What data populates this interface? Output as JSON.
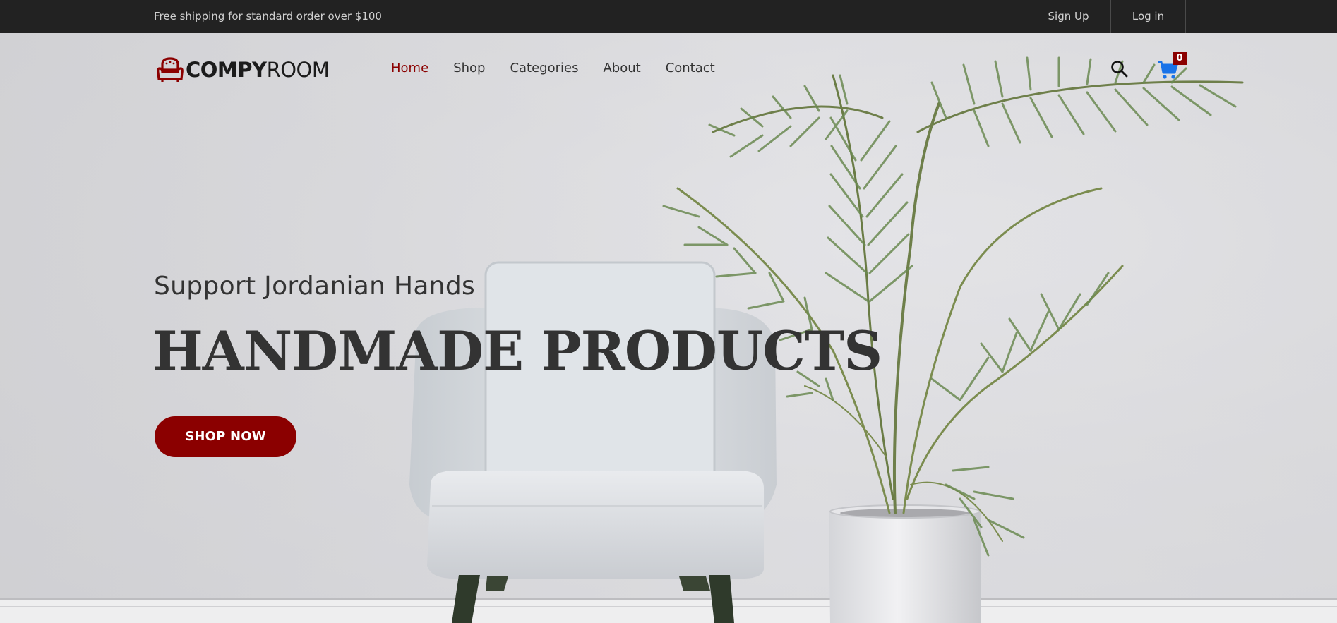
{
  "topbar": {
    "promo": "Free shipping for standard order over $100",
    "signup": "Sign Up",
    "login": "Log in"
  },
  "logo": {
    "bold": "COMPY",
    "light": "ROOM",
    "icon": "armchair-icon",
    "color": "#8b0000"
  },
  "nav": {
    "items": [
      {
        "label": "Home",
        "active": true
      },
      {
        "label": "Shop"
      },
      {
        "label": "Categories"
      },
      {
        "label": "About"
      },
      {
        "label": "Contact"
      }
    ]
  },
  "header": {
    "search_icon": "search-icon",
    "cart_icon": "cart-icon",
    "cart_count": "0"
  },
  "hero": {
    "subtitle": "Support Jordanian Hands",
    "headline": "HANDMADE PRODUCTS",
    "cta": "SHOP NOW"
  },
  "colors": {
    "accent": "#8b0000",
    "topbar": "#222222",
    "cart": "#1a73e8"
  }
}
